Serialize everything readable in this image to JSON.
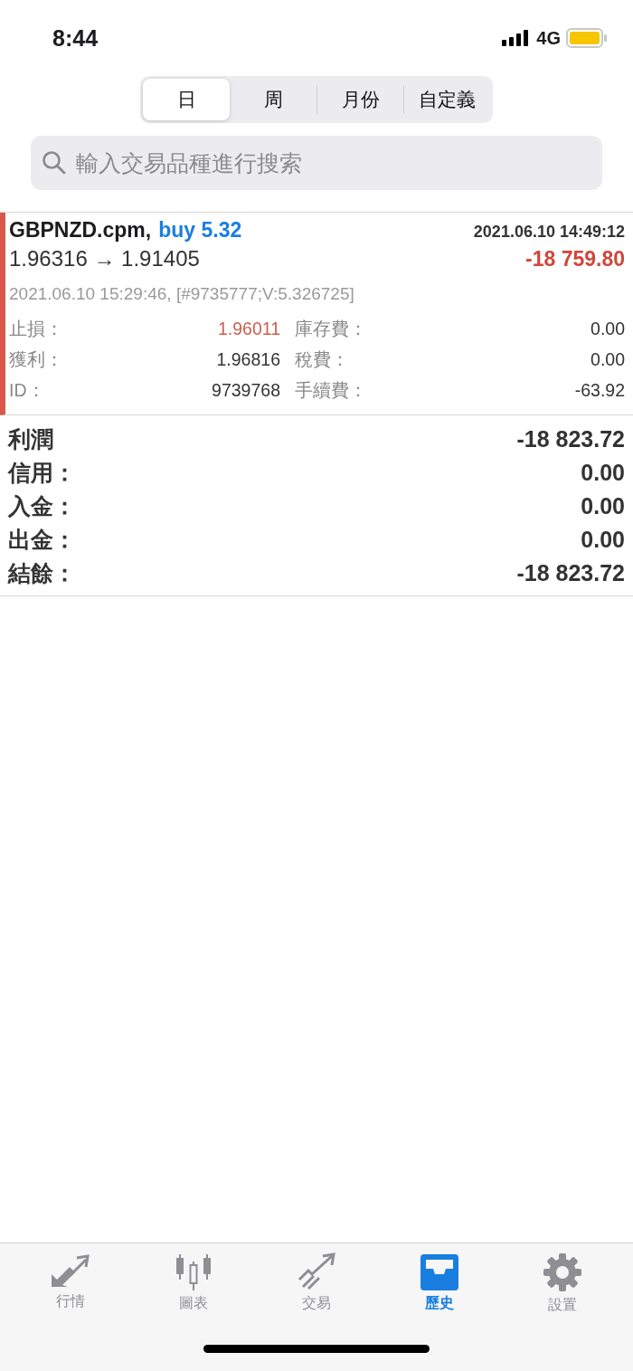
{
  "status_bar": {
    "time": "8:44",
    "network": "4G"
  },
  "period_tabs": [
    {
      "label": "日",
      "selected": true
    },
    {
      "label": "周",
      "selected": false
    },
    {
      "label": "月份",
      "selected": false
    },
    {
      "label": "自定義",
      "selected": false
    }
  ],
  "search": {
    "placeholder": "輸入交易品種進行搜索"
  },
  "deals": [
    {
      "symbol": "GBPNZD.cpm,",
      "action": "buy 5.32",
      "open_time": "2021.06.10 14:49:12",
      "prices": "1.96316 → 1.91405",
      "profit": "-18 759.80",
      "loss": true,
      "close_info": "2021.06.10 15:29:46, [#9735777;V:5.326725]",
      "details": [
        {
          "label": "止損：",
          "value": "1.96011",
          "highlight": true,
          "label_2": "庫存費：",
          "value_2": "0.00"
        },
        {
          "label": "獲利：",
          "value": "1.96816",
          "highlight": false,
          "label_2": "稅費：",
          "value_2": "0.00"
        },
        {
          "label": "ID：",
          "value": "9739768",
          "highlight": false,
          "label_2": "手續費：",
          "value_2": "-63.92"
        }
      ]
    }
  ],
  "summary": [
    {
      "label": "利潤",
      "value": "-18 823.72"
    },
    {
      "label": "信用：",
      "value": "0.00"
    },
    {
      "label": "入金：",
      "value": "0.00"
    },
    {
      "label": "出金：",
      "value": "0.00"
    },
    {
      "label": "結餘：",
      "value": "-18 823.72"
    }
  ],
  "tab_bar": [
    {
      "kind": "quotes",
      "label": "行情",
      "selected": false
    },
    {
      "kind": "chart",
      "label": "圖表",
      "selected": false
    },
    {
      "kind": "trade",
      "label": "交易",
      "selected": false
    },
    {
      "kind": "history",
      "label": "歷史",
      "selected": true
    },
    {
      "kind": "settings",
      "label": "設置",
      "selected": false
    }
  ]
}
